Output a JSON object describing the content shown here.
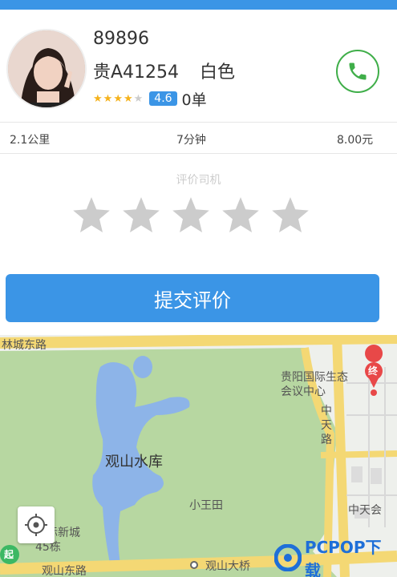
{
  "colors": {
    "accent": "#3b95e6",
    "phone_green": "#3fae49",
    "star_gold": "#f5b21c",
    "star_gray": "#cccccc"
  },
  "driver": {
    "name": "89896",
    "plate": "贵A41254",
    "car_color": "白色",
    "rating_stars": 4,
    "score": "4.6",
    "orders": "0单"
  },
  "trip": {
    "distance": "2.1公里",
    "duration": "7分钟",
    "price": "8.00元"
  },
  "rating": {
    "label": "评价司机",
    "stars": 5,
    "submit_label": "提交评价"
  },
  "map": {
    "labels": {
      "road_top": "林城东路",
      "center": "贵阳国际生态会议中心",
      "center_road": "中天路",
      "lake": "观山水库",
      "village": "小王田",
      "right_area": "中天会",
      "left_area": "国际新城45栋",
      "road_bottom": "观山东路",
      "bridge": "观山大桥",
      "end_marker": "终",
      "start_marker": "起"
    }
  },
  "watermark": {
    "text": "PCPOP下载"
  }
}
